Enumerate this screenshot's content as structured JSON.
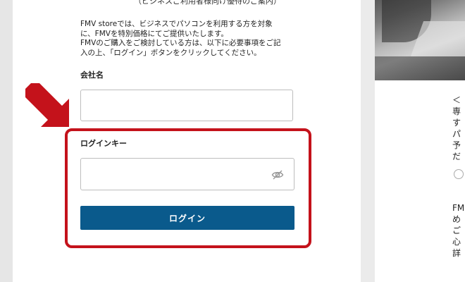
{
  "form": {
    "subtitle": "（ビジネスご利用者様向け優待のご案内）",
    "intro_line1": "FMV storeでは、ビジネスでパソコンを利用する方を対象",
    "intro_line2": "に、FMVを特別価格にてご提供いたします。",
    "intro_line3": "FMVのご購入をご検討している方は、以下に必要事項をご記",
    "intro_line4": "入の上、「ログイン」ボタンをクリックしてください。",
    "company_label": "会社名",
    "company_value": "",
    "login_key_label": "ログインキー",
    "login_key_value": "",
    "login_button": "ログイン"
  },
  "side": {
    "lines": [
      "＜",
      "専",
      "す",
      "パ",
      "予",
      "だ",
      "FM",
      "め",
      "ご",
      "心",
      "詳"
    ]
  },
  "annotation": {
    "highlight_color": "#c4121b",
    "button_color": "#0a5a8c"
  }
}
